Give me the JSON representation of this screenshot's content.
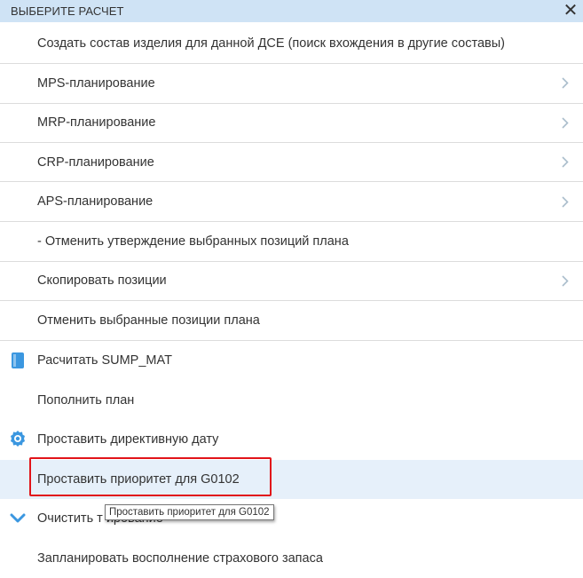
{
  "dialog": {
    "title": "ВЫБЕРИТЕ РАСЧЕТ",
    "close_label": "✕"
  },
  "menu": {
    "items": [
      {
        "label": "Создать состав изделия для данной ДСЕ (поиск вхождения в другие составы)",
        "icon": "",
        "has_submenu": false
      },
      {
        "label": "MPS-планирование",
        "icon": "",
        "has_submenu": true
      },
      {
        "label": "MRP-планирование",
        "icon": "",
        "has_submenu": true
      },
      {
        "label": "CRP-планирование",
        "icon": "",
        "has_submenu": true
      },
      {
        "label": "APS-планирование",
        "icon": "",
        "has_submenu": true
      },
      {
        "label": "- Отменить утверждение выбранных позиций плана",
        "icon": "",
        "has_submenu": false
      },
      {
        "label": "Скопировать позиции",
        "icon": "",
        "has_submenu": true
      },
      {
        "label": "Отменить выбранные позиции плана",
        "icon": "",
        "has_submenu": false
      },
      {
        "label": "Расчитать SUMP_MAT",
        "icon": "bookmark-icon",
        "has_submenu": false
      },
      {
        "label": "Пополнить план",
        "icon": "",
        "has_submenu": false
      },
      {
        "label": "Проставить директивную дату",
        "icon": "gear-badge-icon",
        "has_submenu": false
      },
      {
        "label": "Проставить приоритет для G0102",
        "icon": "",
        "has_submenu": false
      },
      {
        "label": "Очистить т    ирование",
        "icon": "chevron-down-icon",
        "has_submenu": false
      },
      {
        "label": "Запланировать восполнение страхового запаса",
        "icon": "",
        "has_submenu": false
      }
    ]
  },
  "tooltip": {
    "text": "Проставить приоритет для G0102"
  },
  "colors": {
    "header_bg": "#cfe3f5",
    "highlight_bg": "#e6f0fa",
    "icon_blue": "#3b97e0",
    "chevron_gray": "#a9bccb",
    "focus_red": "#e1141a"
  }
}
